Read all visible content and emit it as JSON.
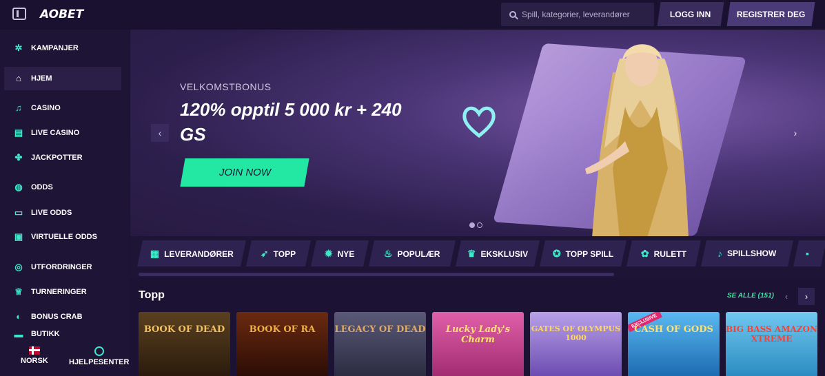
{
  "header": {
    "logo": "AOBET",
    "search_placeholder": "Spill, kategorier, leverandører",
    "login_label": "LOGG INN",
    "register_label": "REGISTRER DEG"
  },
  "sidebar": {
    "items": [
      {
        "label": "KAMPANJER",
        "icon": "gear-icon"
      },
      {
        "label": "HJEM",
        "icon": "home-icon"
      },
      {
        "label": "CASINO",
        "icon": "casino-icon"
      },
      {
        "label": "LIVE CASINO",
        "icon": "live-casino-icon"
      },
      {
        "label": "JACKPOTTER",
        "icon": "clover-icon"
      },
      {
        "label": "ODDS",
        "icon": "odds-icon"
      },
      {
        "label": "LIVE ODDS",
        "icon": "live-odds-icon"
      },
      {
        "label": "VIRTUELLE ODDS",
        "icon": "virtual-odds-icon"
      },
      {
        "label": "UTFORDRINGER",
        "icon": "challenge-icon"
      },
      {
        "label": "TURNERINGER",
        "icon": "trophy-icon"
      },
      {
        "label": "BONUS CRAB",
        "icon": "crab-icon"
      },
      {
        "label": "BUTIKK",
        "icon": "shop-icon"
      }
    ],
    "language_label": "NORSK",
    "help_label": "HJELPESENTER"
  },
  "hero": {
    "subtitle": "VELKOMSTBONUS",
    "title": "120% opptil 5 000 kr + 240 GS",
    "cta_label": "JOIN NOW"
  },
  "categories": [
    {
      "label": "LEVERANDØRER",
      "icon": "grid-icon"
    },
    {
      "label": "TOPP",
      "icon": "rocket-icon"
    },
    {
      "label": "NYE",
      "icon": "new-icon"
    },
    {
      "label": "POPULÆR",
      "icon": "fire-icon"
    },
    {
      "label": "EKSKLUSIV",
      "icon": "crown-icon"
    },
    {
      "label": "TOPP SPILL",
      "icon": "star-icon"
    },
    {
      "label": "RULETT",
      "icon": "roulette-icon"
    },
    {
      "label": "SPILLSHOW",
      "icon": "microphone-icon"
    }
  ],
  "games_section": {
    "title": "Topp",
    "see_all_label": "SE ALLE (151)",
    "tiles": [
      {
        "title": "BOOK OF DEAD",
        "color": "#3a2a16"
      },
      {
        "title": "BOOK OF RA",
        "color": "#4a1a10"
      },
      {
        "title": "LEGACY OF DEAD",
        "color": "#3b3a55"
      },
      {
        "title": "Lucky Lady's Charm",
        "color": "#c23d8a"
      },
      {
        "title": "GATES OF OLYMPUS 1000",
        "color": "#8a6fc7"
      },
      {
        "title": "CASH OF GODS",
        "color": "#2f8fd6",
        "badge": "EXCLUSIVE"
      },
      {
        "title": "BIG BASS AMAZON XTREME",
        "color": "#3fa0cf"
      }
    ]
  }
}
